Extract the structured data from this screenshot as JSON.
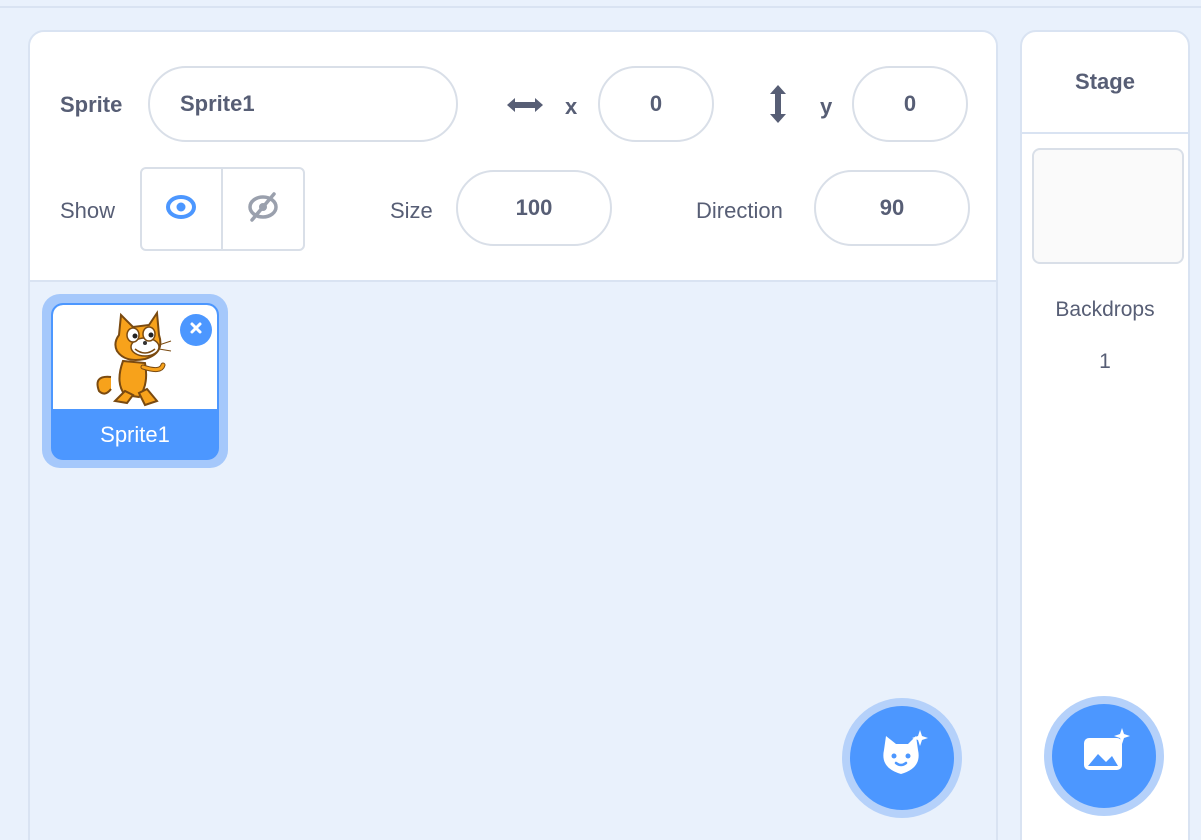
{
  "sprite_info": {
    "sprite_label": "Sprite",
    "sprite_name": "Sprite1",
    "x_label": "x",
    "x_value": "0",
    "y_label": "y",
    "y_value": "0",
    "show_label": "Show",
    "size_label": "Size",
    "size_value": "100",
    "direction_label": "Direction",
    "direction_value": "90"
  },
  "sprite_list": {
    "items": [
      {
        "label": "Sprite1",
        "selected": true
      }
    ]
  },
  "stage": {
    "title": "Stage",
    "backdrops_label": "Backdrops",
    "backdrops_count": "1"
  },
  "icons": {
    "x_arrow": "horizontal-arrow-icon",
    "y_arrow": "vertical-arrow-icon",
    "show": "eye-icon",
    "hide": "eye-hidden-icon",
    "delete": "close-icon",
    "add_sprite": "cat-add-icon",
    "add_backdrop": "image-add-icon"
  },
  "colors": {
    "accent": "#4c97ff",
    "background": "#e9f1fc",
    "text": "#575e75"
  }
}
